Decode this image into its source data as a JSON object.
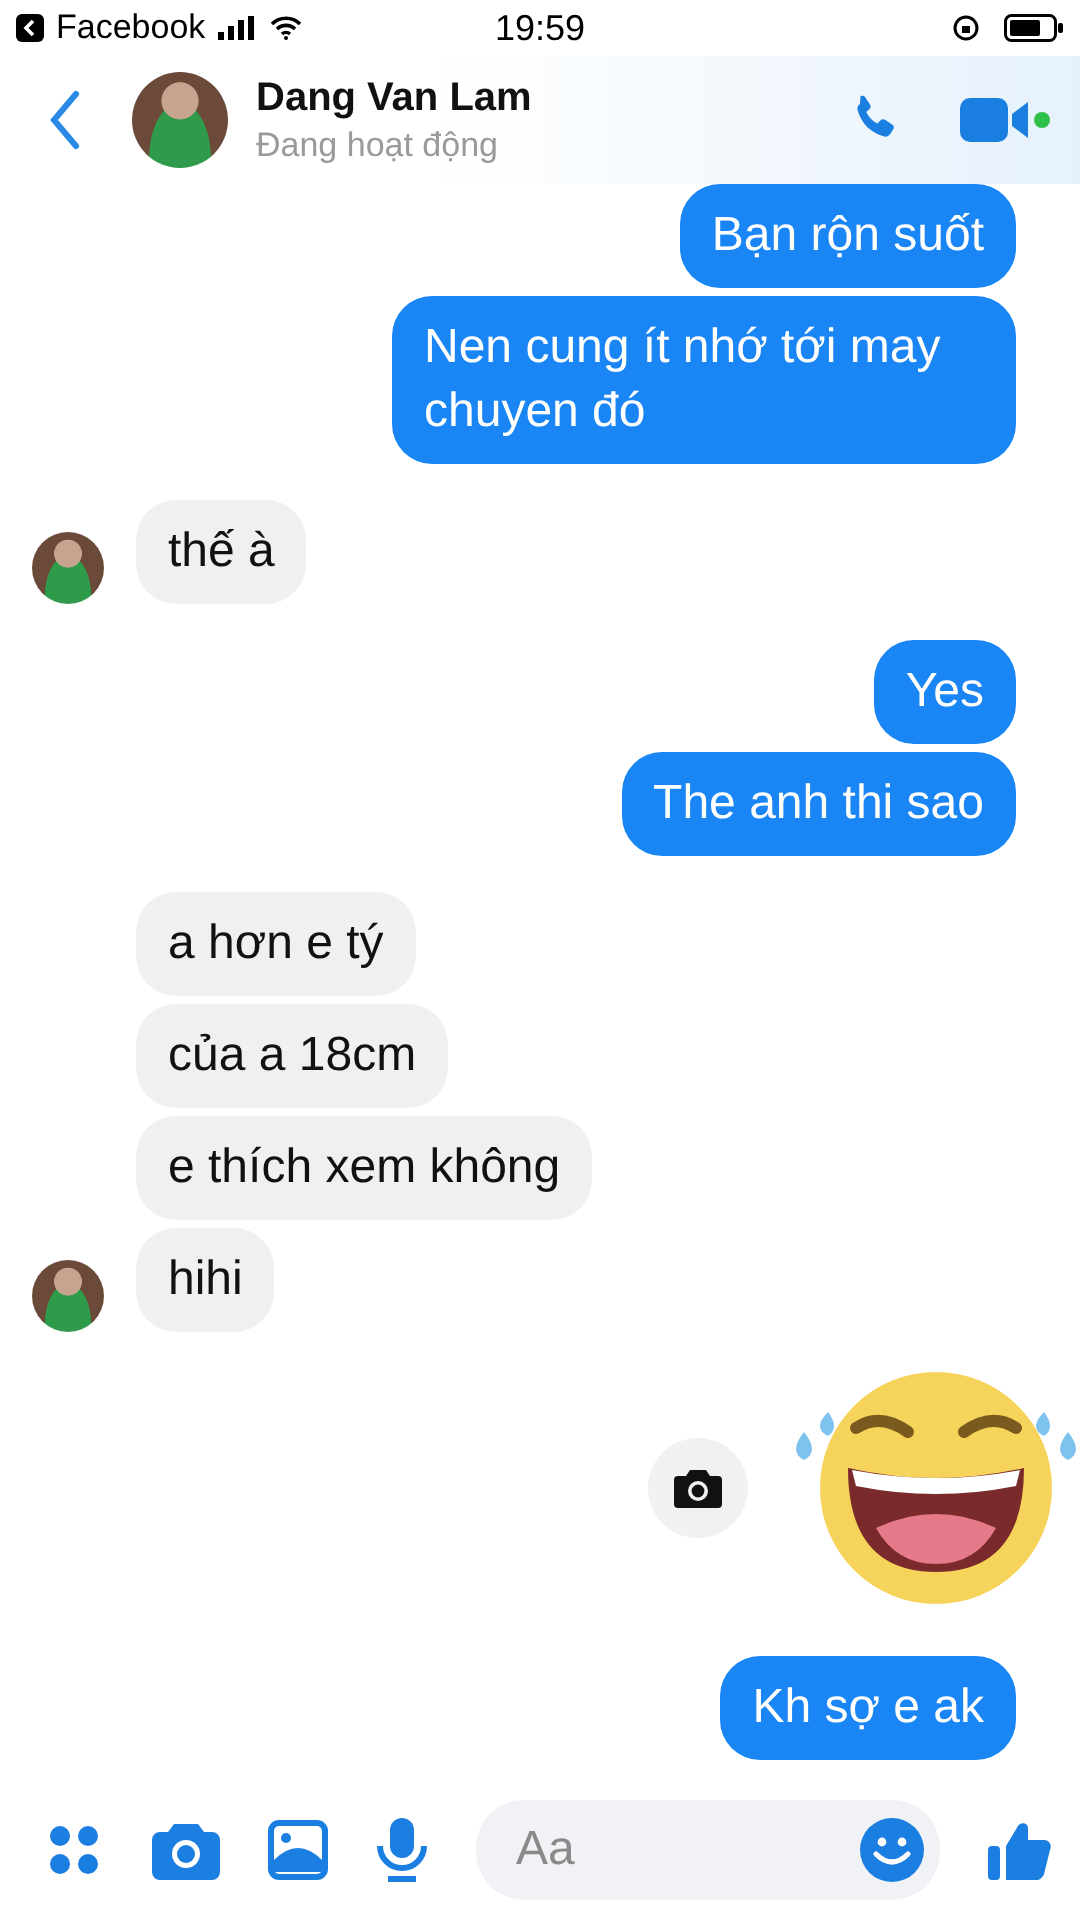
{
  "status_bar": {
    "back_app": "Facebook",
    "time": "19:59"
  },
  "header": {
    "name": "Dang Van Lam",
    "status": "Đang hoạt động"
  },
  "messages": [
    {
      "kind": "outgoing",
      "text": "Bạn rộn suốt"
    },
    {
      "kind": "outgoing",
      "text": "Nen cung ít nhớ tới may chuyen đó"
    },
    {
      "kind": "incoming",
      "text": "thế à",
      "show_avatar": true
    },
    {
      "kind": "outgoing",
      "text": "Yes"
    },
    {
      "kind": "outgoing",
      "text": "The anh thi sao"
    },
    {
      "kind": "incoming",
      "text": "a hơn e tý",
      "show_avatar": false
    },
    {
      "kind": "incoming",
      "text": "của a 18cm",
      "show_avatar": false
    },
    {
      "kind": "incoming",
      "text": "e thích xem không",
      "show_avatar": false
    },
    {
      "kind": "incoming",
      "text": "hihi",
      "show_avatar": true
    },
    {
      "kind": "sticker"
    },
    {
      "kind": "outgoing",
      "text": "Kh sợ e ak"
    }
  ],
  "composer": {
    "placeholder": "Aa"
  }
}
